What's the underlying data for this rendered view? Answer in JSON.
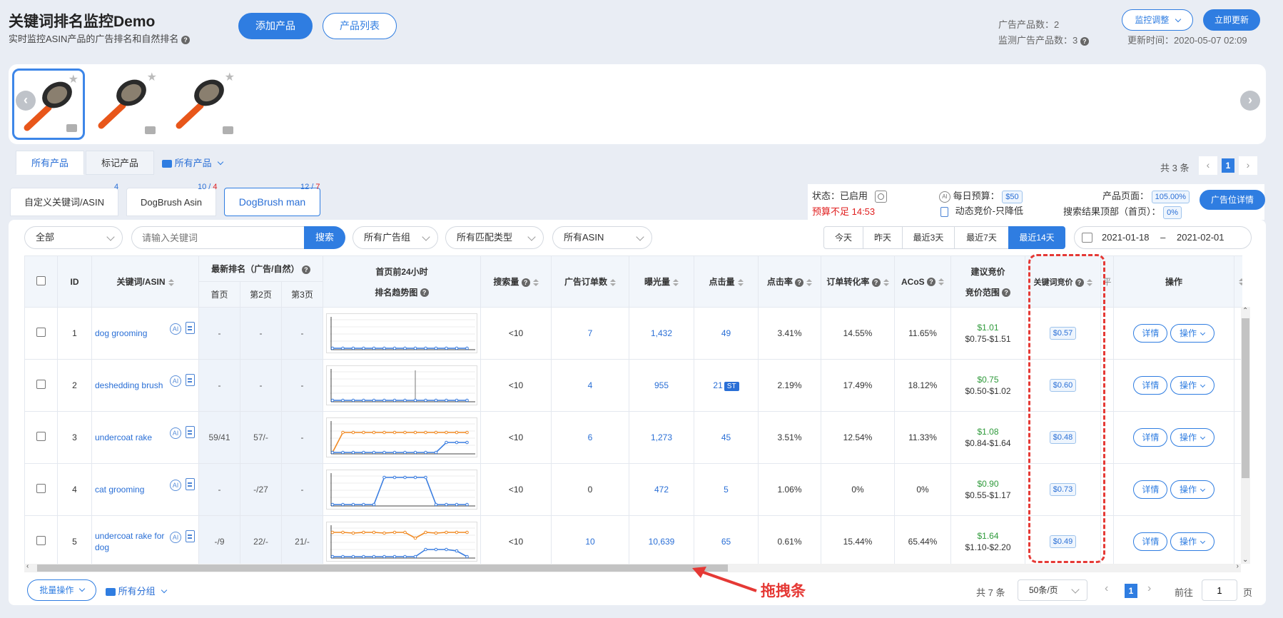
{
  "header": {
    "title": "关键词排名监控Demo",
    "subtitle": "实时监控ASIN产品的广告排名和自然排名",
    "add_product": "添加产品",
    "product_list": "产品列表",
    "ad_count_label": "广告产品数：",
    "ad_count": "2",
    "monitor_count_label": "监测广告产品数：",
    "monitor_count": "3",
    "monitor_adjust": "监控调整",
    "refresh_now": "立即更新",
    "update_time_label": "更新时间：",
    "update_time": "2020-05-07 02:09"
  },
  "product_tabs": {
    "all": "所有产品",
    "marked": "标记产品",
    "folder": "所有产品"
  },
  "pager_top": {
    "total": "共 3 条",
    "page": "1"
  },
  "kw_tabs": [
    {
      "label": "自定义关键词/ASIN",
      "badge": "4"
    },
    {
      "label": "DogBrush Asin",
      "badge_a": "10",
      "badge_sep": " / ",
      "badge_b": "4"
    },
    {
      "label": "DogBrush man",
      "badge_a": "12",
      "badge_sep": " / ",
      "badge_b": "7"
    }
  ],
  "status": {
    "state_label": "状态：",
    "state": "已启用",
    "budget_warn": "预算不足 14:53",
    "daily_budget_label": "每日预算：",
    "daily_budget": "$50",
    "dynamic": "动态竞价-只降低",
    "page_label": "产品页面：",
    "page_val": "105.00%",
    "top_label": "搜索结果顶部（首页）：",
    "top_val": "0%",
    "ad_detail": "广告位详情"
  },
  "filters": {
    "scope": "全部",
    "search_placeholder": "请输入关键词",
    "search_btn": "搜索",
    "group": "所有广告组",
    "match": "所有匹配类型",
    "asin": "所有ASIN",
    "dates": [
      "今天",
      "昨天",
      "最近3天",
      "最近7天",
      "最近14天"
    ],
    "date_from": "2021-01-18",
    "date_to": "2021-02-01",
    "date_sep": "–"
  },
  "columns": {
    "id": "ID",
    "kw": "关键词/ASIN",
    "rank": "最新排名（广告/自然）",
    "p1": "首页",
    "p2": "第2页",
    "p3": "第3页",
    "trend1": "首页前24小时",
    "trend2": "排名趋势图",
    "search": "搜索量",
    "orders": "广告订单数",
    "impr": "曝光量",
    "clicks": "点击量",
    "ctr": "点击率",
    "cvr": "订单转化率",
    "acos": "ACoS",
    "sug1": "建议竞价",
    "sug2": "竞价范围",
    "bid": "关键词竞价",
    "cut": "平",
    "ops": "操作"
  },
  "rows": [
    {
      "id": "1",
      "kw": "dog grooming",
      "p1": "-",
      "p2": "-",
      "p3": "-",
      "search": "<10",
      "orders": "7",
      "impr": "1,432",
      "clicks": "49",
      "st": "",
      "ctr": "3.41%",
      "cvr": "14.55%",
      "acos": "11.65%",
      "sug": "$1.01",
      "range": "$0.75-$1.51",
      "bid": "$0.57",
      "spark": "flat"
    },
    {
      "id": "2",
      "kw": "deshedding brush",
      "p1": "-",
      "p2": "-",
      "p3": "-",
      "search": "<10",
      "orders": "4",
      "impr": "955",
      "clicks": "21",
      "st": "ST",
      "ctr": "2.19%",
      "cvr": "17.49%",
      "acos": "18.12%",
      "sug": "$0.75",
      "range": "$0.50-$1.02",
      "bid": "$0.60",
      "spark": "spike"
    },
    {
      "id": "3",
      "kw": "undercoat rake",
      "p1": "59/41",
      "p2": "57/-",
      "p3": "-",
      "search": "<10",
      "orders": "6",
      "impr": "1,273",
      "clicks": "45",
      "st": "",
      "ctr": "3.51%",
      "cvr": "12.54%",
      "acos": "11.33%",
      "sug": "$1.08",
      "range": "$0.84-$1.64",
      "bid": "$0.48",
      "spark": "dual"
    },
    {
      "id": "4",
      "kw": "cat grooming",
      "p1": "-",
      "p2": "-/27",
      "p3": "-",
      "search": "<10",
      "orders": "0",
      "impr": "472",
      "clicks": "5",
      "st": "",
      "ctr": "1.06%",
      "cvr": "0%",
      "acos": "0%",
      "sug": "$0.90",
      "range": "$0.55-$1.17",
      "bid": "$0.73",
      "spark": "bump"
    },
    {
      "id": "5",
      "kw": "undercoat rake for dog",
      "p1": "-/9",
      "p2": "22/-",
      "p3": "21/-",
      "search": "<10",
      "orders": "10",
      "impr": "10,639",
      "clicks": "65",
      "st": "",
      "ctr": "0.61%",
      "cvr": "15.44%",
      "acos": "65.44%",
      "sug": "$1.64",
      "range": "$1.10-$2.20",
      "bid": "$0.49",
      "spark": "dual2"
    }
  ],
  "row_actions": {
    "detail": "详情",
    "ops": "操作"
  },
  "footer": {
    "batch": "批量操作",
    "group": "所有分组",
    "total": "共 7 条",
    "per_page": "50条/页",
    "page": "1",
    "goto_label": "前往",
    "goto_val": "1",
    "goto_unit": "页"
  },
  "annotation": "拖拽条",
  "colors": {
    "accent": "#2f7de1",
    "warn": "#e02020",
    "annot": "#e53935"
  }
}
